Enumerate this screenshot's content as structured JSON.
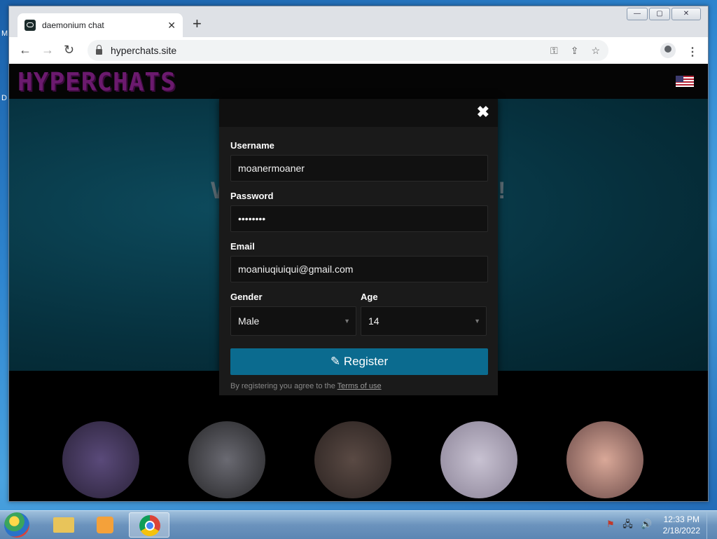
{
  "desktop": {
    "peek_top": "M",
    "peek_mid": "D"
  },
  "browser": {
    "tab_title": "daemonium chat",
    "tab_close": "✕",
    "new_tab": "+",
    "window_controls": {
      "minimize": "—",
      "maximize": "▢",
      "close": "✕"
    },
    "nav": {
      "back": "←",
      "forward": "→",
      "reload": "↻"
    },
    "url": "hyperchats.site",
    "icons": [
      "key-icon",
      "share-icon",
      "star-icon",
      "profile-icon",
      "menu-icon"
    ]
  },
  "site": {
    "logo": "HYPERCHATS",
    "hero_left": "W",
    "hero_right": "!"
  },
  "modal": {
    "close": "✖",
    "username_label": "Username",
    "username_value": "moanermoaner",
    "password_label": "Password",
    "password_value": "••••••••",
    "email_label": "Email",
    "email_value": "moaniuqiuiqui@gmail.com",
    "gender_label": "Gender",
    "gender_value": "Male",
    "age_label": "Age",
    "age_value": "14",
    "register_label": "Register",
    "terms_prefix": "By registering you agree to the ",
    "terms_link": "Terms of use"
  },
  "taskbar": {
    "time": "12:33 PM",
    "date": "2/18/2022",
    "tray_icons": [
      "flag-icon",
      "network-icon",
      "volume-icon"
    ]
  },
  "colors": {
    "modal_bg": "#1a1a1a",
    "register_bg": "#0b6b8f",
    "hero_bg": "#06303d",
    "logo": "#6b1a6e"
  }
}
